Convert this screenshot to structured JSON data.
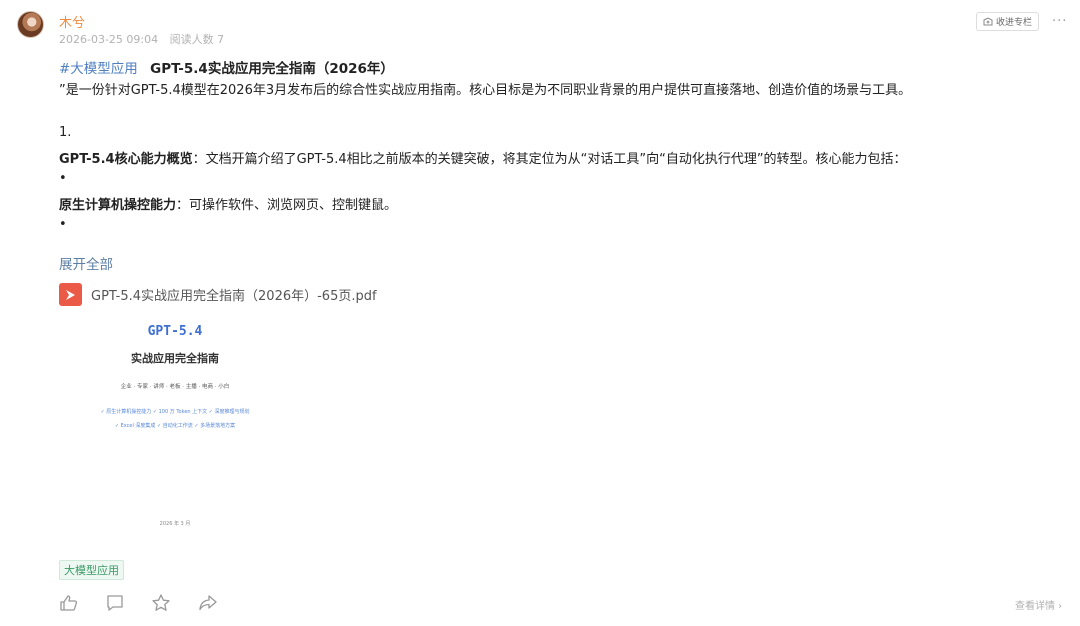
{
  "post": {
    "author": "木兮",
    "date": "2026-03-25 09:04",
    "reads": "阅读人数 7",
    "collect_label": "收进专栏",
    "more_label": "···",
    "hashtag": "#大模型应用",
    "title": "GPT-5.4实战应用完全指南（2026年）",
    "intro": "”是一份针对GPT-5.4模型在2026年3月发布后的综合性实战应用指南。核心目标是为不同职业背景的用户提供可直接落地、创造价值的场景与工具。",
    "num1": "1.",
    "item1_bold": "GPT-5.4核心能力概览",
    "item1_text": "：文档开篇介绍了GPT-5.4相比之前版本的关键突破，将其定位为从“对话工具”向“自动化执行代理”的转型。核心能力包括：",
    "bullet": "•",
    "item2_bold": "原生计算机操控能力",
    "item2_text": "：可操作软件、浏览网页、控制键鼠。",
    "expand_label": "展开全部",
    "file_name": "GPT-5.4实战应用完全指南（2026年）-65页.pdf",
    "tag": "大模型应用",
    "details_label": "查看详情 ›"
  },
  "preview": {
    "title": "GPT-5.4",
    "subtitle": "实战应用完全指南",
    "audience": "企业 · 专家 · 讲师 · 老板 · 主播 · 电商 · 小白",
    "features1": "✓ 原生计算机操控能力  ✓ 100 万 Token 上下文  ✓ 深度推理与规划",
    "features2": "✓ Excel 深度集成  ✓ 自动化工作流  ✓ 多场景落地方案",
    "date": "2026 年 3 月"
  },
  "icons": {
    "like": "thumbs-up-icon",
    "comment": "comment-icon",
    "star": "star-icon",
    "share": "share-icon",
    "pdf": "pdf-icon",
    "collect": "collect-icon"
  },
  "colors": {
    "author": "#f08a3c",
    "hashtag": "#4e7fc1",
    "expand": "#5d7fa6",
    "pdf": "#ea5a47",
    "tag_text": "#3a9a64",
    "tag_bg": "#eef8f2"
  }
}
